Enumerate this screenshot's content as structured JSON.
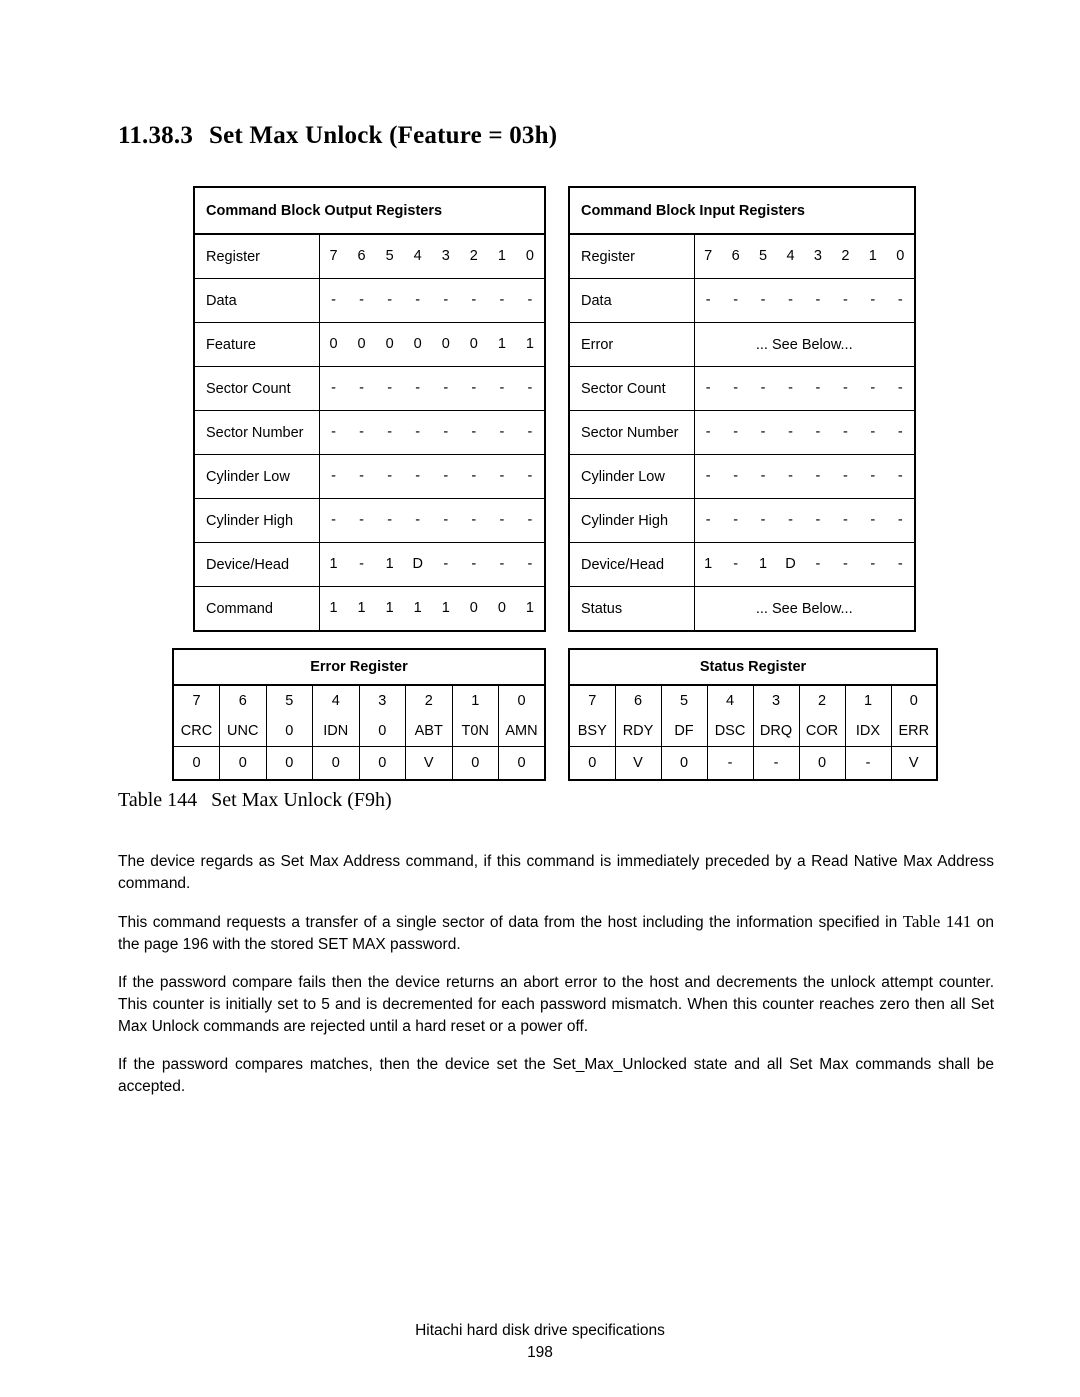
{
  "heading": {
    "number": "11.38.3",
    "title": "Set Max Unlock (Feature = 03h)"
  },
  "output_registers": {
    "title": "Command Block Output Registers",
    "rows": [
      {
        "name": "Register",
        "bits": [
          "7",
          "6",
          "5",
          "4",
          "3",
          "2",
          "1",
          "0"
        ]
      },
      {
        "name": "Data",
        "bits": [
          "-",
          "-",
          "-",
          "-",
          "-",
          "-",
          "-",
          "-"
        ]
      },
      {
        "name": "Feature",
        "bits": [
          "0",
          "0",
          "0",
          "0",
          "0",
          "0",
          "1",
          "1"
        ]
      },
      {
        "name": "Sector Count",
        "bits": [
          "-",
          "-",
          "-",
          "-",
          "-",
          "-",
          "-",
          "-"
        ]
      },
      {
        "name": "Sector Number",
        "bits": [
          "-",
          "-",
          "-",
          "-",
          "-",
          "-",
          "-",
          "-"
        ]
      },
      {
        "name": "Cylinder Low",
        "bits": [
          "-",
          "-",
          "-",
          "-",
          "-",
          "-",
          "-",
          "-"
        ]
      },
      {
        "name": "Cylinder High",
        "bits": [
          "-",
          "-",
          "-",
          "-",
          "-",
          "-",
          "-",
          "-"
        ]
      },
      {
        "name": "Device/Head",
        "bits": [
          "1",
          "-",
          "1",
          "D",
          "-",
          "-",
          "-",
          "-"
        ]
      },
      {
        "name": "Command",
        "bits": [
          "1",
          "1",
          "1",
          "1",
          "1",
          "0",
          "0",
          "1"
        ]
      }
    ]
  },
  "input_registers": {
    "title": "Command Block Input Registers",
    "see_below": "... See Below...",
    "rows": [
      {
        "name": "Register",
        "bits": [
          "7",
          "6",
          "5",
          "4",
          "3",
          "2",
          "1",
          "0"
        ]
      },
      {
        "name": "Data",
        "bits": [
          "-",
          "-",
          "-",
          "-",
          "-",
          "-",
          "-",
          "-"
        ]
      },
      {
        "name": "Error",
        "bits": null
      },
      {
        "name": "Sector Count",
        "bits": [
          "-",
          "-",
          "-",
          "-",
          "-",
          "-",
          "-",
          "-"
        ]
      },
      {
        "name": "Sector Number",
        "bits": [
          "-",
          "-",
          "-",
          "-",
          "-",
          "-",
          "-",
          "-"
        ]
      },
      {
        "name": "Cylinder Low",
        "bits": [
          "-",
          "-",
          "-",
          "-",
          "-",
          "-",
          "-",
          "-"
        ]
      },
      {
        "name": "Cylinder High",
        "bits": [
          "-",
          "-",
          "-",
          "-",
          "-",
          "-",
          "-",
          "-"
        ]
      },
      {
        "name": "Device/Head",
        "bits": [
          "1",
          "-",
          "1",
          "D",
          "-",
          "-",
          "-",
          "-"
        ]
      },
      {
        "name": "Status",
        "bits": null
      }
    ]
  },
  "error_register": {
    "title": "Error Register",
    "bit_numbers": [
      "7",
      "6",
      "5",
      "4",
      "3",
      "2",
      "1",
      "0"
    ],
    "mnemonics": [
      "CRC",
      "UNC",
      "0",
      "IDN",
      "0",
      "ABT",
      "T0N",
      "AMN"
    ],
    "values": [
      "0",
      "0",
      "0",
      "0",
      "0",
      "V",
      "0",
      "0"
    ]
  },
  "status_register": {
    "title": "Status Register",
    "bit_numbers": [
      "7",
      "6",
      "5",
      "4",
      "3",
      "2",
      "1",
      "0"
    ],
    "mnemonics": [
      "BSY",
      "RDY",
      "DF",
      "DSC",
      "DRQ",
      "COR",
      "IDX",
      "ERR"
    ],
    "values": [
      "0",
      "V",
      "0",
      "-",
      "-",
      "0",
      "-",
      "V"
    ]
  },
  "caption": {
    "label": "Table 144",
    "text": "Set Max Unlock (F9h)"
  },
  "paragraphs": {
    "p1": "The device regards as Set Max Address command, if this command is immediately preceded by a Read Native Max Address command.",
    "p2_before": "This command requests a transfer of a single sector of data from the host including the information specified in",
    "p2_ref": "Table 141",
    "p2_after": "on the page 196 with the stored SET MAX password.",
    "p3": "If the password compare fails then the device returns an abort error to the host and decrements the unlock attempt counter. This counter is initially set to 5 and is decremented for each password mismatch. When this counter reaches zero then all Set Max Unlock commands are rejected until a hard reset or a power off.",
    "p4": "If the password compares matches, then the device set the Set_Max_Unlocked state and all Set Max commands shall be accepted."
  },
  "footer": {
    "line1": "Hitachi hard disk drive specifications",
    "line2": "198"
  }
}
